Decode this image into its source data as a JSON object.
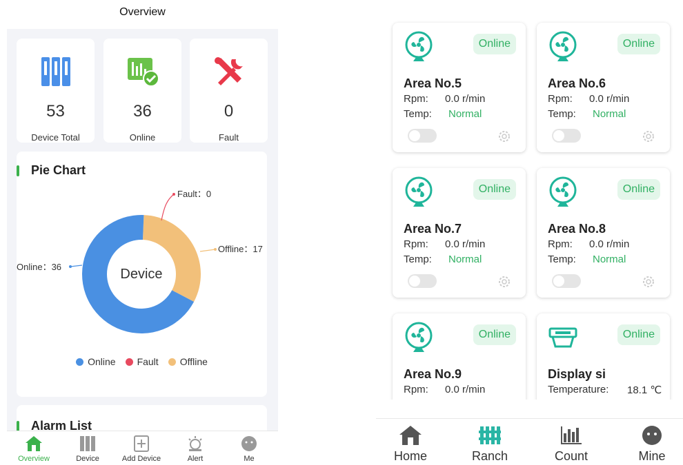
{
  "overview": {
    "title": "Overview",
    "stats": [
      {
        "value": "53",
        "label": "Device Total",
        "icon": "device-total-icon"
      },
      {
        "value": "36",
        "label": "Online",
        "icon": "online-icon"
      },
      {
        "value": "0",
        "label": "Fault",
        "icon": "fault-icon"
      }
    ],
    "pie_title": "Pie Chart",
    "alarm_title": "Alarm List",
    "chart_data": {
      "type": "pie",
      "center_label": "Device",
      "categories": [
        "Online",
        "Fault",
        "Offline"
      ],
      "values": [
        36,
        0,
        17
      ],
      "colors": [
        "#4a90e2",
        "#e84a5f",
        "#f2c07a"
      ],
      "slice_labels": [
        "Online：36",
        "Fault：0",
        "Offline：17"
      ],
      "legend": [
        "Online",
        "Fault",
        "Offline"
      ],
      "legend_position": "bottom"
    },
    "tabs": [
      {
        "label": "Overview",
        "icon": "home-icon",
        "active": true
      },
      {
        "label": "Device",
        "icon": "device-icon",
        "active": false
      },
      {
        "label": "Add Device",
        "icon": "add-device-icon",
        "active": false
      },
      {
        "label": "Alert",
        "icon": "alert-icon",
        "active": false
      },
      {
        "label": "Me",
        "icon": "me-icon",
        "active": false
      }
    ]
  },
  "devices": {
    "cards": [
      {
        "name": "Area No.5",
        "status": "Online",
        "rpm_label": "Rpm:",
        "rpm": "0.0 r/min",
        "temp_label": "Temp:",
        "temp": "Normal",
        "icon": "fan-icon"
      },
      {
        "name": "Area No.6",
        "status": "Online",
        "rpm_label": "Rpm:",
        "rpm": "0.0 r/min",
        "temp_label": "Temp:",
        "temp": "Normal",
        "icon": "fan-icon"
      },
      {
        "name": "Area No.7",
        "status": "Online",
        "rpm_label": "Rpm:",
        "rpm": "0.0 r/min",
        "temp_label": "Temp:",
        "temp": "Normal",
        "icon": "fan-icon"
      },
      {
        "name": "Area No.8",
        "status": "Online",
        "rpm_label": "Rpm:",
        "rpm": "0.0 r/min",
        "temp_label": "Temp:",
        "temp": "Normal",
        "icon": "fan-icon"
      },
      {
        "name": "Area No.9",
        "status": "Online",
        "rpm_label": "Rpm:",
        "rpm": "0.0 r/min",
        "icon": "fan-icon"
      },
      {
        "name": "Display si",
        "status": "Online",
        "temp_label": "Temperature:",
        "temp_value": "18.1 ℃",
        "icon": "display-screen-icon"
      }
    ],
    "tabs": [
      {
        "label": "Home",
        "icon": "home-icon"
      },
      {
        "label": "Ranch",
        "icon": "ranch-icon"
      },
      {
        "label": "Count",
        "icon": "count-icon"
      },
      {
        "label": "Mine",
        "icon": "mine-icon"
      }
    ],
    "accent": "#31b063"
  }
}
